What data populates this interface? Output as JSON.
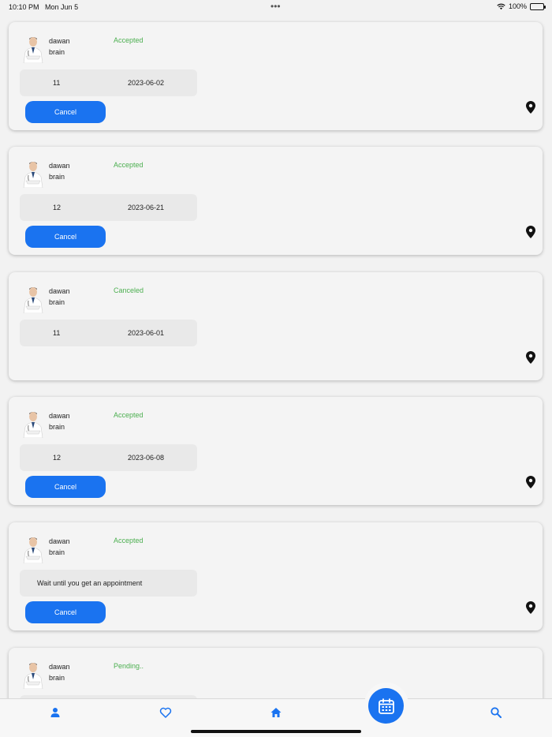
{
  "status_bar": {
    "time": "10:10 PM",
    "date": "Mon Jun 5",
    "battery": "100%"
  },
  "appointments": [
    {
      "doctor": "dawan",
      "specialty": "brain",
      "status": "Accepted",
      "number": "11",
      "date": "2023-06-02",
      "cancel_label": "Cancel"
    },
    {
      "doctor": "dawan",
      "specialty": "brain",
      "status": "Accepted",
      "number": "12",
      "date": "2023-06-21",
      "cancel_label": "Cancel"
    },
    {
      "doctor": "dawan",
      "specialty": "brain",
      "status": "Canceled",
      "number": "11",
      "date": "2023-06-01"
    },
    {
      "doctor": "dawan",
      "specialty": "brain",
      "status": "Accepted",
      "number": "12",
      "date": "2023-06-08",
      "cancel_label": "Cancel"
    },
    {
      "doctor": "dawan",
      "specialty": "brain",
      "status": "Accepted",
      "message": "Wait until you get an appointment",
      "cancel_label": "Cancel"
    },
    {
      "doctor": "dawan",
      "specialty": "brain",
      "status": "Pending.."
    }
  ],
  "tabbar": {
    "items": [
      "person-icon",
      "heart-icon",
      "home-icon",
      "calendar-icon",
      "search-icon"
    ],
    "accent": "#1a73f0"
  },
  "colors": {
    "accent": "#1a73f0",
    "status_green": "#4caf50"
  }
}
